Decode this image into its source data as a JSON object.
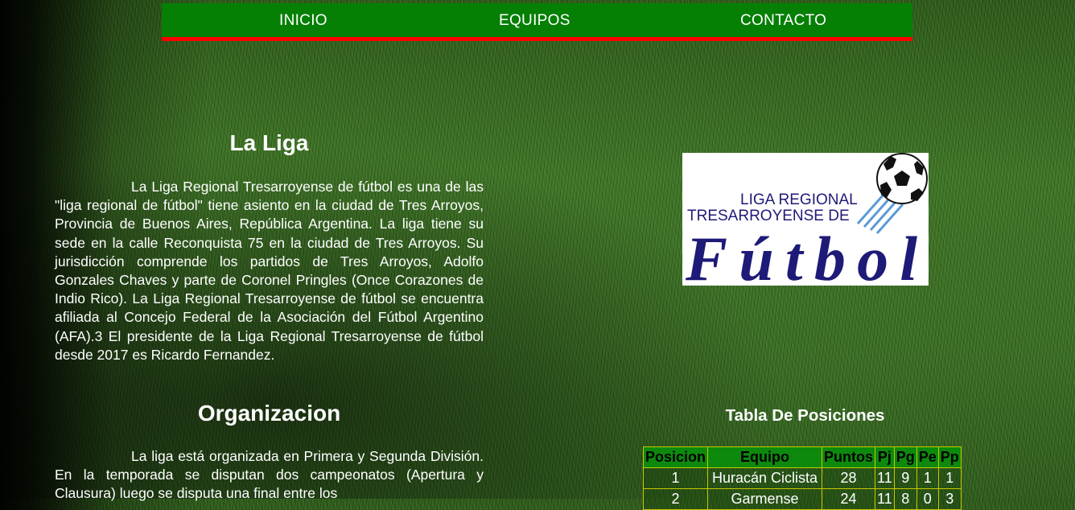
{
  "nav": {
    "items": [
      {
        "label": "INICIO"
      },
      {
        "label": "EQUIPOS"
      },
      {
        "label": "CONTACTO"
      }
    ]
  },
  "liga": {
    "title": "La Liga",
    "text": "La Liga Regional Tresarroyense de fútbol es una de las \"liga regional de fútbol\" tiene asiento en la ciudad de Tres Arroyos, Provincia de Buenos Aires, República Argentina. La liga tiene su sede en la calle Reconquista 75 en la ciudad de Tres Arroyos. Su jurisdicción comprende los partidos de Tres Arroyos, Adolfo Gonzales Chaves y parte de Coronel Pringles (Once Corazones de Indio Rico). La Liga Regional Tresarroyense de fútbol se encuentra afiliada al Concejo Federal de la Asociación del Fútbol Argentino (AFA).3 El presidente de la Liga Regional Tresarroyense de fútbol desde 2017 es Ricardo Fernandez."
  },
  "organizacion": {
    "title": "Organizacion",
    "text": "La liga está organizada en Primera y Segunda División. En la temporada se disputan dos campeonatos (Apertura y Clausura) luego se disputa una final entre los"
  },
  "logo": {
    "line1": "LIGA REGIONAL",
    "line2": "TRESARROYENSE DE",
    "word": "Fútbol",
    "navy": "#1e1a78",
    "sky": "#5a9ad8"
  },
  "tabla": {
    "title": "Tabla De Posiciones",
    "headers": [
      "Posicion",
      "Equipo",
      "Puntos",
      "Pj",
      "Pg",
      "Pe",
      "Pp"
    ],
    "rows": [
      [
        "1",
        "Huracán Ciclista",
        "28",
        "11",
        "9",
        "1",
        "1"
      ],
      [
        "2",
        "Garmense",
        "24",
        "11",
        "8",
        "0",
        "3"
      ]
    ]
  },
  "colors": {
    "nav_bg": "#058005",
    "nav_border": "#ff0000",
    "table_border": "#c8c800"
  }
}
